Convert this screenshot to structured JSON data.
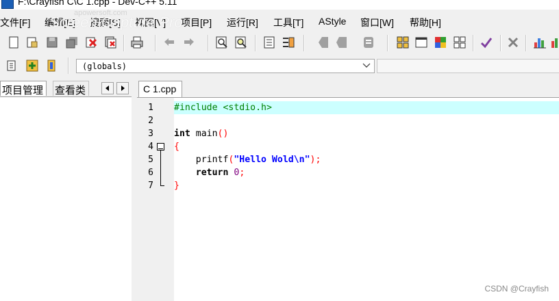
{
  "window": {
    "title": "F:\\Crayfish C\\C 1.cpp - Dev-C++ 5.11"
  },
  "watermark": {
    "text": "Screen Capture Pro",
    "url": "apowersoft.com"
  },
  "menu": [
    {
      "label": "文件[F]"
    },
    {
      "label": "编辑[E]"
    },
    {
      "label": "搜索[S]"
    },
    {
      "label": "视图[V]"
    },
    {
      "label": "项目[P]"
    },
    {
      "label": "运行[R]"
    },
    {
      "label": "工具[T]"
    },
    {
      "label": "AStyle"
    },
    {
      "label": "窗口[W]"
    },
    {
      "label": "帮助[H]"
    }
  ],
  "toolbar": {
    "icons": [
      "new-file-icon",
      "open-file-icon",
      "save-icon",
      "save-all-icon",
      "close-file-icon",
      "close-all-icon",
      "print-icon",
      "undo-icon",
      "redo-icon",
      "find-icon",
      "replace-icon",
      "indent-icon",
      "unindent-icon",
      "compile-icon",
      "run-icon",
      "compile-run-icon",
      "rebuild-icon",
      "debug-icon",
      "grid-view-icon",
      "window-icon",
      "class-browser-icon",
      "tiles-icon",
      "check-icon",
      "delete-icon",
      "chart-icon"
    ]
  },
  "scope": {
    "selected": "(globals)"
  },
  "left_panel": {
    "tabs": [
      {
        "label": "项目管理",
        "active": true
      },
      {
        "label": "查看类",
        "active": false
      }
    ]
  },
  "editor": {
    "file_tab": "C 1.cpp",
    "current_line": 1,
    "lines": [
      {
        "num": "1",
        "tokens": [
          {
            "t": "#include <stdio.h>",
            "c": "pre"
          }
        ]
      },
      {
        "num": "2",
        "tokens": []
      },
      {
        "num": "3",
        "tokens": [
          {
            "t": "int",
            "c": "kw"
          },
          {
            "t": " main",
            "c": "plain"
          },
          {
            "t": "()",
            "c": "sym"
          }
        ]
      },
      {
        "num": "4",
        "tokens": [
          {
            "t": "{",
            "c": "sym"
          }
        ]
      },
      {
        "num": "5",
        "tokens": [
          {
            "t": "    printf",
            "c": "plain"
          },
          {
            "t": "(",
            "c": "sym"
          },
          {
            "t": "\"Hello Wold\\n\"",
            "c": "str"
          },
          {
            "t": ");",
            "c": "sym"
          }
        ]
      },
      {
        "num": "6",
        "tokens": [
          {
            "t": "    ",
            "c": "plain"
          },
          {
            "t": "return",
            "c": "kw"
          },
          {
            "t": " ",
            "c": "plain"
          },
          {
            "t": "0",
            "c": "num"
          },
          {
            "t": ";",
            "c": "sym"
          }
        ]
      },
      {
        "num": "7",
        "tokens": [
          {
            "t": "}",
            "c": "sym"
          }
        ]
      }
    ]
  },
  "credit": {
    "text": "CSDN @Crayfish"
  }
}
